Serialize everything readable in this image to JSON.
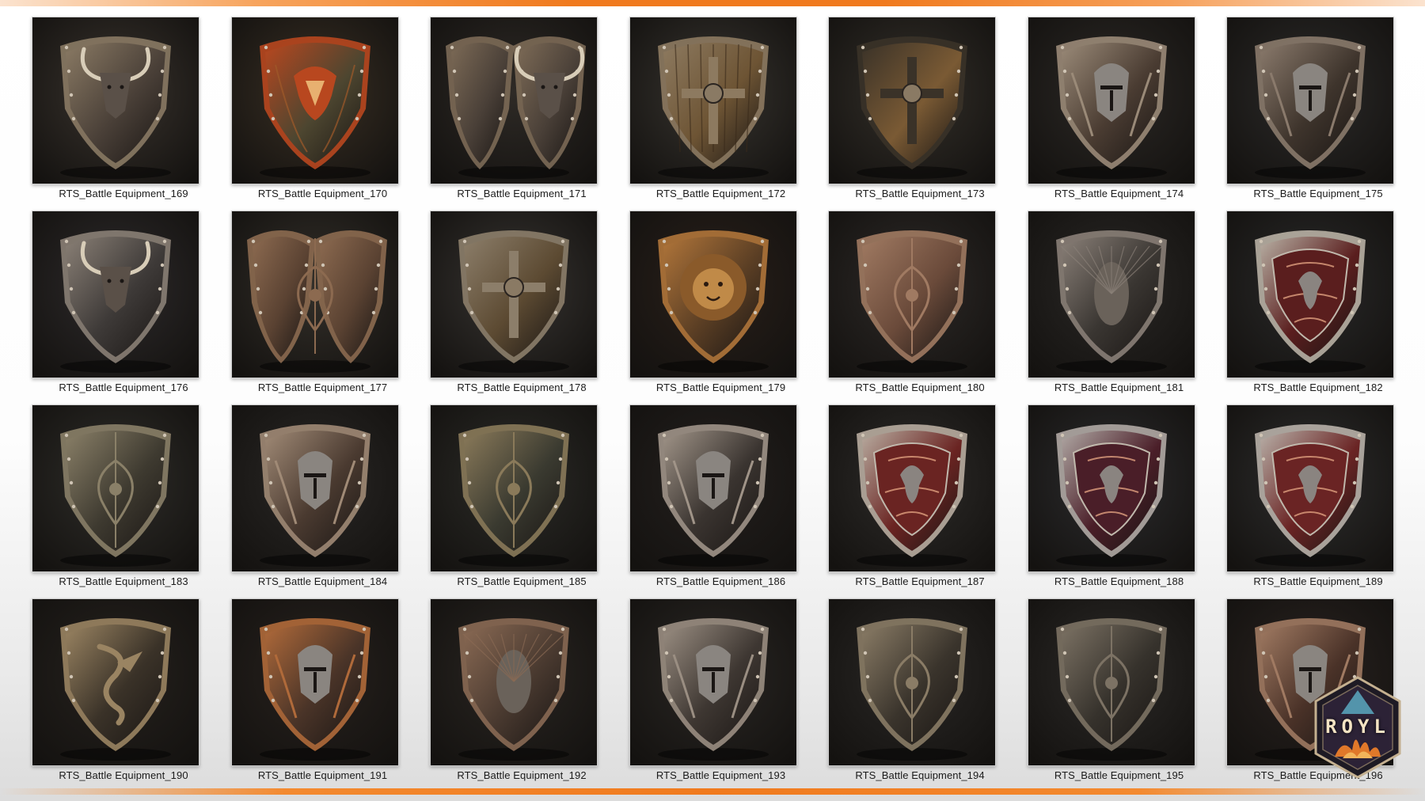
{
  "gallery": {
    "columns": 7,
    "items": [
      {
        "label": "RTS_Battle Equipment_169",
        "style": "bull",
        "tone": "#3a342e",
        "face": "#4a4038",
        "accent": "#8a7a64"
      },
      {
        "label": "RTS_Battle Equipment_170",
        "style": "heraldic",
        "tone": "#3a3024",
        "face": "#4d4630",
        "accent": "#b8471f"
      },
      {
        "label": "RTS_Battle Equipment_171",
        "style": "double-bull",
        "tone": "#2e2a26",
        "face": "#4a4038",
        "accent": "#7c6a56"
      },
      {
        "label": "RTS_Battle Equipment_172",
        "style": "wood",
        "tone": "#383530",
        "face": "#6d5434",
        "accent": "#8d7a60"
      },
      {
        "label": "RTS_Battle Equipment_173",
        "style": "cross",
        "tone": "#34302a",
        "face": "#7a5a34",
        "accent": "#3a3228"
      },
      {
        "label": "RTS_Battle Equipment_174",
        "style": "helm",
        "tone": "#2c2926",
        "face": "#4a3c32",
        "accent": "#9a8a78"
      },
      {
        "label": "RTS_Battle Equipment_175",
        "style": "helm",
        "tone": "#2c2b2a",
        "face": "#3e342c",
        "accent": "#8a7a6c"
      },
      {
        "label": "RTS_Battle Equipment_176",
        "style": "bull",
        "tone": "#2e2b2c",
        "face": "#3e3a38",
        "accent": "#8a8076"
      },
      {
        "label": "RTS_Battle Equipment_177",
        "style": "double",
        "tone": "#34302a",
        "face": "#5a4232",
        "accent": "#8c6a50"
      },
      {
        "label": "RTS_Battle Equipment_178",
        "style": "cross",
        "tone": "#383532",
        "face": "#5c4a32",
        "accent": "#8c7e6a"
      },
      {
        "label": "RTS_Battle Equipment_179",
        "style": "lion",
        "tone": "#2a201a",
        "face": "#5a3e24",
        "accent": "#b0753a"
      },
      {
        "label": "RTS_Battle Equipment_180",
        "style": "ornate",
        "tone": "#2e2a28",
        "face": "#6a4a3a",
        "accent": "#a07a62"
      },
      {
        "label": "RTS_Battle Equipment_181",
        "style": "round",
        "tone": "#2a2826",
        "face": "#3a3632",
        "accent": "#8a8078"
      },
      {
        "label": "RTS_Battle Equipment_182",
        "style": "red",
        "tone": "#2a2a2a",
        "face": "#5a1e1e",
        "accent": "#b8b0a4"
      },
      {
        "label": "RTS_Battle Equipment_183",
        "style": "ornate",
        "tone": "#2f2e2a",
        "face": "#3e3a30",
        "accent": "#8a8068"
      },
      {
        "label": "RTS_Battle Equipment_184",
        "style": "helm",
        "tone": "#2a2826",
        "face": "#4a3a30",
        "accent": "#a08a76"
      },
      {
        "label": "RTS_Battle Equipment_185",
        "style": "ornate",
        "tone": "#2c2c28",
        "face": "#3a3a30",
        "accent": "#8a7a5a"
      },
      {
        "label": "RTS_Battle Equipment_186",
        "style": "helm",
        "tone": "#24201e",
        "face": "#3a3430",
        "accent": "#a09488"
      },
      {
        "label": "RTS_Battle Equipment_187",
        "style": "red",
        "tone": "#2e2c2a",
        "face": "#6a2422",
        "accent": "#b8aca0"
      },
      {
        "label": "RTS_Battle Equipment_188",
        "style": "red",
        "tone": "#2c2c2e",
        "face": "#4a1e28",
        "accent": "#b0a8a4"
      },
      {
        "label": "RTS_Battle Equipment_189",
        "style": "red",
        "tone": "#2e2e2e",
        "face": "#6a2424",
        "accent": "#b8b0a8"
      },
      {
        "label": "RTS_Battle Equipment_190",
        "style": "dragon",
        "tone": "#26221e",
        "face": "#3a3228",
        "accent": "#9a8462"
      },
      {
        "label": "RTS_Battle Equipment_191",
        "style": "helm",
        "tone": "#28221e",
        "face": "#4a3428",
        "accent": "#b06a3a"
      },
      {
        "label": "RTS_Battle Equipment_192",
        "style": "round",
        "tone": "#2a2622",
        "face": "#4a3a30",
        "accent": "#8a6a54"
      },
      {
        "label": "RTS_Battle Equipment_193",
        "style": "helm",
        "tone": "#2a2724",
        "face": "#3e3732",
        "accent": "#9a8e82"
      },
      {
        "label": "RTS_Battle Equipment_194",
        "style": "ornate",
        "tone": "#2a2826",
        "face": "#3a342c",
        "accent": "#8a7c66"
      },
      {
        "label": "RTS_Battle Equipment_195",
        "style": "ornate",
        "tone": "#2c2a28",
        "face": "#36322c",
        "accent": "#7c7264"
      },
      {
        "label": "RTS_Battle Equipment_196",
        "style": "helm",
        "tone": "#2a2320",
        "face": "#4a3228",
        "accent": "#a07a62"
      }
    ]
  },
  "branding": {
    "logo_text": "ROYL",
    "logo_colors": {
      "outer": "#1e1a24",
      "ring": "#c4b090",
      "flame": "#e0782a",
      "inner": "#3c2a4a"
    },
    "accent_color": "#f07a1e"
  }
}
